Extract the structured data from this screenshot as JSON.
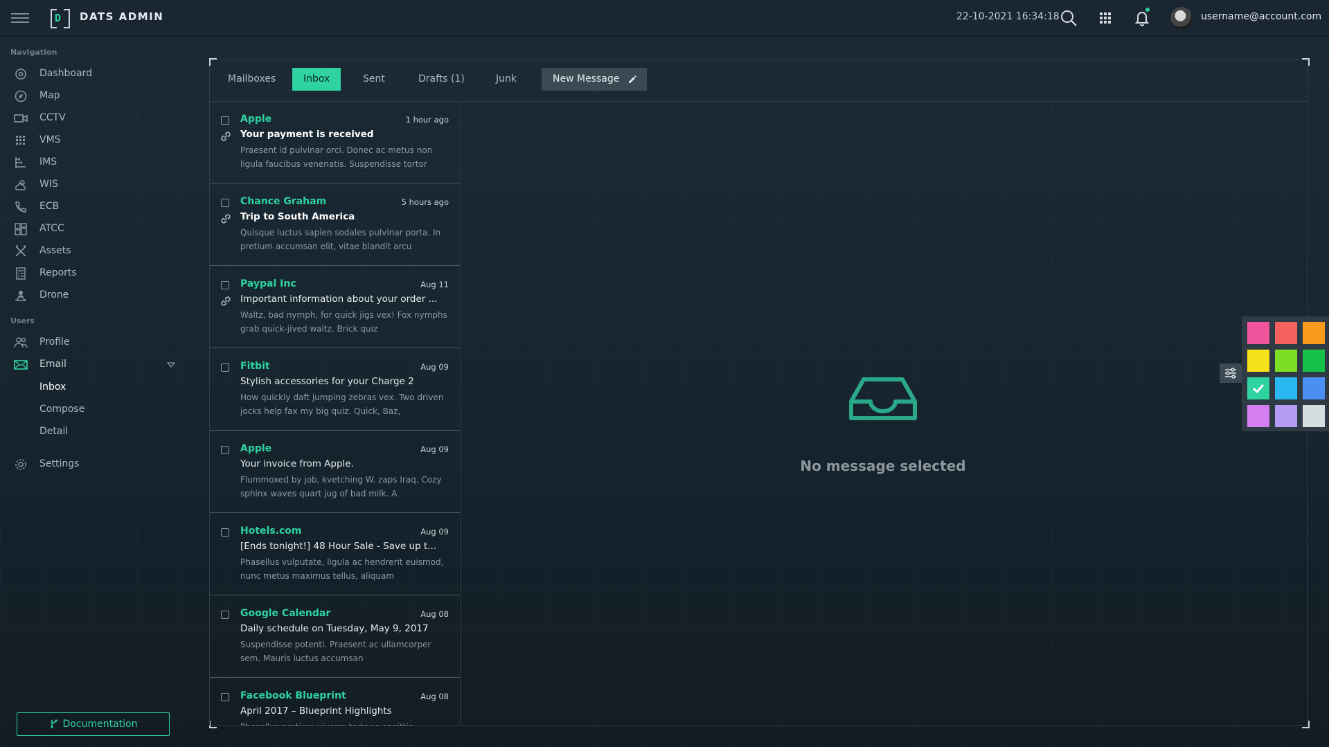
{
  "app": {
    "title": "DATS ADMIN",
    "logo_letter": "D"
  },
  "header": {
    "datetime": "22-10-2021 16:34:18",
    "user_email": "username@account.com"
  },
  "sidebar": {
    "navigation_label": "Navigation",
    "nav_items": [
      {
        "label": "Dashboard",
        "icon": "dashboard-icon"
      },
      {
        "label": "Map",
        "icon": "compass-icon"
      },
      {
        "label": "CCTV",
        "icon": "camera-icon"
      },
      {
        "label": "VMS",
        "icon": "grid-dots-icon"
      },
      {
        "label": "IMS",
        "icon": "hierarchy-icon"
      },
      {
        "label": "WIS",
        "icon": "weather-icon"
      },
      {
        "label": "ECB",
        "icon": "phone-icon"
      },
      {
        "label": "ATCC",
        "icon": "tiles-icon"
      },
      {
        "label": "Assets",
        "icon": "tools-icon"
      },
      {
        "label": "Reports",
        "icon": "calculator-icon"
      },
      {
        "label": "Drone",
        "icon": "drone-icon"
      }
    ],
    "users_label": "Users",
    "user_items": [
      {
        "label": "Profile",
        "icon": "users-icon"
      },
      {
        "label": "Email",
        "icon": "envelope-icon"
      }
    ],
    "email_subitems": [
      "Inbox",
      "Compose",
      "Detail"
    ],
    "settings_label": "Settings",
    "documentation_label": "Documentation"
  },
  "tabs": {
    "mailboxes": "Mailboxes",
    "inbox": "Inbox",
    "sent": "Sent",
    "drafts": "Drafts (1)",
    "junk": "Junk",
    "new_message": "New Message",
    "active": "Inbox"
  },
  "messages": [
    {
      "from": "Apple",
      "time": "1 hour ago",
      "subject": "Your payment is received",
      "unread": true,
      "attachment": true,
      "preview": "Praesent id pulvinar orci. Donec ac metus non ligula faucibus venenatis. Suspendisse tortor"
    },
    {
      "from": "Chance Graham",
      "time": "5 hours ago",
      "subject": "Trip to South America",
      "unread": true,
      "attachment": true,
      "preview": "Quisque luctus sapien sodales pulvinar porta. In pretium accumsan elit, vitae blandit arcu"
    },
    {
      "from": "Paypal Inc",
      "time": "Aug 11",
      "subject": "Important information about your order ...",
      "unread": false,
      "attachment": true,
      "preview": "Waltz, bad nymph, for quick jigs vex! Fox nymphs grab quick-jived waltz. Brick quiz"
    },
    {
      "from": "Fitbit",
      "time": "Aug 09",
      "subject": "Stylish accessories for your Charge 2",
      "unread": false,
      "attachment": false,
      "preview": "How quickly daft jumping zebras vex. Two driven jocks help fax my big quiz. Quick, Baz,"
    },
    {
      "from": "Apple",
      "time": "Aug 09",
      "subject": "Your invoice from Apple.",
      "unread": false,
      "attachment": false,
      "preview": "Flummoxed by job, kvetching W. zaps Iraq. Cozy sphinx waves quart jug of bad milk. A"
    },
    {
      "from": "Hotels.com",
      "time": "Aug 09",
      "subject": "[Ends tonight!] 48 Hour Sale - Save up t...",
      "unread": false,
      "attachment": false,
      "preview": "Phasellus vulputate, ligula ac hendrerit euismod, nunc metus maximus tellus, aliquam"
    },
    {
      "from": "Google Calendar",
      "time": "Aug 08",
      "subject": "Daily schedule on Tuesday, May 9, 2017",
      "unread": false,
      "attachment": false,
      "preview": "Suspendisse potenti. Praesent ac ullamcorper sem. Mauris luctus accumsan"
    },
    {
      "from": "Facebook Blueprint",
      "time": "Aug 08",
      "subject": "April 2017 – Blueprint Highlights",
      "unread": false,
      "attachment": false,
      "preview": "Phasellus pretium viverra tortor a sagittis"
    }
  ],
  "empty_state": {
    "text": "No message selected"
  },
  "palette": {
    "colors": [
      "#f0549d",
      "#f4625e",
      "#f79a1c",
      "#f6e11a",
      "#7ddd24",
      "#17c24b",
      "#2ed3a0",
      "#27b9f0",
      "#4c8ff2",
      "#d57ef0",
      "#b49cf5",
      "#d6dde0"
    ],
    "selected": "#2ed3a0"
  },
  "colors": {
    "accent": "#2ed3a0"
  }
}
